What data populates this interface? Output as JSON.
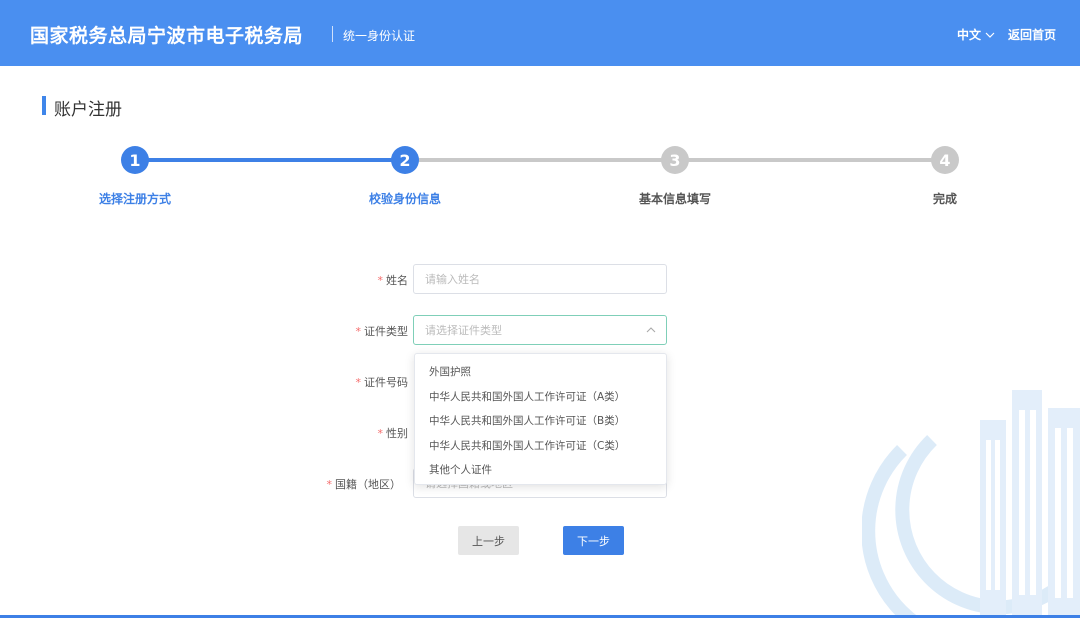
{
  "header": {
    "brand": "国家税务总局宁波市电子税务局",
    "subtitle": "统一身份认证",
    "lang": "中文",
    "home_link": "返回首页"
  },
  "page_title": "账户注册",
  "steps": [
    {
      "num": "1",
      "label": "选择注册方式",
      "state": "active"
    },
    {
      "num": "2",
      "label": "校验身份信息",
      "state": "active"
    },
    {
      "num": "3",
      "label": "基本信息填写",
      "state": "inactive"
    },
    {
      "num": "4",
      "label": "完成",
      "state": "inactive"
    }
  ],
  "form": {
    "name": {
      "label": "姓名",
      "placeholder": "请输入姓名"
    },
    "id_type": {
      "label": "证件类型",
      "placeholder": "请选择证件类型"
    },
    "id_number": {
      "label": "证件号码"
    },
    "gender": {
      "label": "性别"
    },
    "nationality": {
      "label": "国籍（地区）",
      "placeholder": "请选择国籍或地区"
    },
    "required_mark": "*"
  },
  "dropdown_options": [
    "外国护照",
    "中华人民共和国外国人工作许可证（A类）",
    "中华人民共和国外国人工作许可证（B类）",
    "中华人民共和国外国人工作许可证（C类）",
    "其他个人证件"
  ],
  "buttons": {
    "prev": "上一步",
    "next": "下一步"
  },
  "colors": {
    "header_bg": "#4a8ff0",
    "primary": "#3d80e6",
    "inactive_step": "#c9c9c9",
    "focus_border": "#7fcfb8"
  },
  "icons": {
    "lang_dropdown": "chevron-down-icon",
    "select_arrow": "chevron-up-icon",
    "watermark": "tax-bureau-emblem"
  }
}
